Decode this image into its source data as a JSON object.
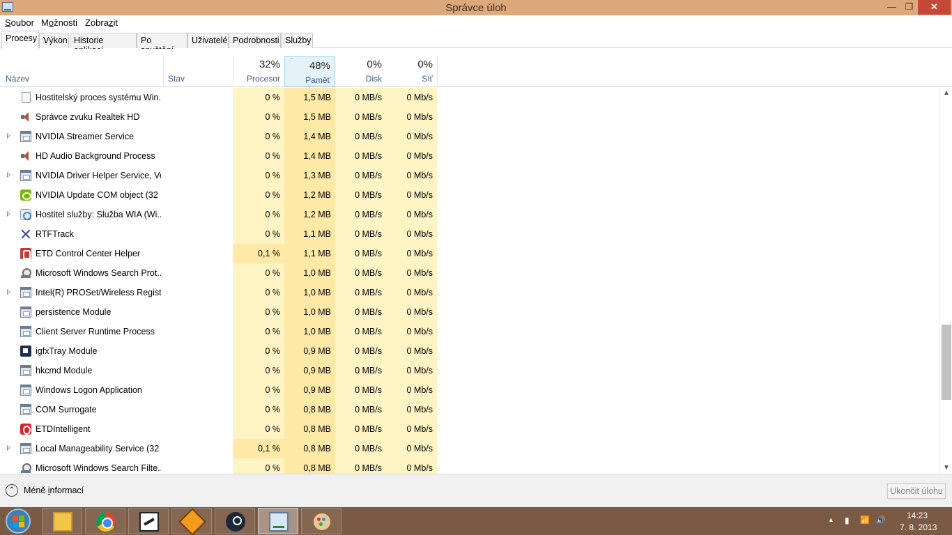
{
  "window": {
    "title": "Správce úloh",
    "minimize_icon": "minimize-icon",
    "maximize_icon": "maximize-icon",
    "close_icon": "close-icon",
    "minimize_glyph": "—",
    "maximize_glyph": "❐",
    "close_glyph": "✕"
  },
  "menu": [
    {
      "label": "Soubor",
      "underline": "S",
      "rest": "oubor"
    },
    {
      "label": "Možnosti",
      "pre": "M",
      "underline": "o",
      "rest": "žnosti"
    },
    {
      "label": "Zobrazit",
      "pre": "Zobra",
      "underline": "z",
      "rest": "it"
    }
  ],
  "tabs": [
    "Procesy",
    "Výkon",
    "Historie aplikací",
    "Po spuštění",
    "Uživatelé",
    "Podrobnosti",
    "Služby"
  ],
  "active_tab": "Procesy",
  "columns": {
    "name": "Název",
    "status": "Stav",
    "cpu": {
      "pct": "32%",
      "label": "Procesor"
    },
    "memory": {
      "pct": "48%",
      "label": "Paměť",
      "sort_glyph": "ˇ"
    },
    "disk": {
      "pct": "0%",
      "label": "Disk"
    },
    "network": {
      "pct": "0%",
      "label": "Síť"
    }
  },
  "processes": [
    {
      "name": "Hostitelský proces systému Win...",
      "icon": "doc-icon",
      "expandable": false,
      "cpu": "0 %",
      "mem": "1,5 MB",
      "disk": "0 MB/s",
      "net": "0 Mb/s"
    },
    {
      "name": "Správce zvuku Realtek HD",
      "icon": "speaker-icon",
      "expandable": false,
      "cpu": "0 %",
      "mem": "1,5 MB",
      "disk": "0 MB/s",
      "net": "0 Mb/s"
    },
    {
      "name": "NVIDIA Streamer Service",
      "icon": "window-app-icon",
      "expandable": true,
      "cpu": "0 %",
      "mem": "1,4 MB",
      "disk": "0 MB/s",
      "net": "0 Mb/s"
    },
    {
      "name": "HD Audio Background Process",
      "icon": "speaker-icon",
      "expandable": false,
      "cpu": "0 %",
      "mem": "1,4 MB",
      "disk": "0 MB/s",
      "net": "0 Mb/s"
    },
    {
      "name": "NVIDIA Driver Helper Service, Ve...",
      "icon": "window-app-icon",
      "expandable": true,
      "cpu": "0 %",
      "mem": "1,3 MB",
      "disk": "0 MB/s",
      "net": "0 Mb/s"
    },
    {
      "name": "NVIDIA Update COM object (32 ...",
      "icon": "nvidia-icon",
      "expandable": false,
      "cpu": "0 %",
      "mem": "1,2 MB",
      "disk": "0 MB/s",
      "net": "0 Mb/s"
    },
    {
      "name": "Hostitel služby: Služba WIA (Wi...",
      "icon": "gear-icon",
      "expandable": true,
      "cpu": "0 %",
      "mem": "1,2 MB",
      "disk": "0 MB/s",
      "net": "0 Mb/s"
    },
    {
      "name": "RTFTrack",
      "icon": "rtftrack-icon",
      "expandable": false,
      "cpu": "0 %",
      "mem": "1,1 MB",
      "disk": "0 MB/s",
      "net": "0 Mb/s"
    },
    {
      "name": "ETD Control Center Helper",
      "icon": "etd-icon",
      "expandable": false,
      "cpu": "0,1 %",
      "mem": "1,1 MB",
      "disk": "0 MB/s",
      "net": "0 Mb/s"
    },
    {
      "name": "Microsoft Windows Search Prot...",
      "icon": "search-user-icon",
      "expandable": false,
      "cpu": "0 %",
      "mem": "1,0 MB",
      "disk": "0 MB/s",
      "net": "0 Mb/s"
    },
    {
      "name": "Intel(R) PROSet/Wireless Registr...",
      "icon": "window-app-icon",
      "expandable": true,
      "cpu": "0 %",
      "mem": "1,0 MB",
      "disk": "0 MB/s",
      "net": "0 Mb/s"
    },
    {
      "name": "persistence Module",
      "icon": "window-app-icon",
      "expandable": false,
      "cpu": "0 %",
      "mem": "1,0 MB",
      "disk": "0 MB/s",
      "net": "0 Mb/s"
    },
    {
      "name": "Client Server Runtime Process",
      "icon": "window-app-icon",
      "expandable": false,
      "cpu": "0 %",
      "mem": "1,0 MB",
      "disk": "0 MB/s",
      "net": "0 Mb/s"
    },
    {
      "name": "igfxTray Module",
      "icon": "igfx-tray-icon",
      "expandable": false,
      "cpu": "0 %",
      "mem": "0,9 MB",
      "disk": "0 MB/s",
      "net": "0 Mb/s"
    },
    {
      "name": "hkcmd Module",
      "icon": "window-app-icon",
      "expandable": false,
      "cpu": "0 %",
      "mem": "0,9 MB",
      "disk": "0 MB/s",
      "net": "0 Mb/s"
    },
    {
      "name": "Windows Logon Application",
      "icon": "window-app-icon",
      "expandable": false,
      "cpu": "0 %",
      "mem": "0,9 MB",
      "disk": "0 MB/s",
      "net": "0 Mb/s"
    },
    {
      "name": "COM Surrogate",
      "icon": "window-app-icon",
      "expandable": false,
      "cpu": "0 %",
      "mem": "0,8 MB",
      "disk": "0 MB/s",
      "net": "0 Mb/s"
    },
    {
      "name": "ETDIntelligent",
      "icon": "etd-intelligent-icon",
      "expandable": false,
      "cpu": "0 %",
      "mem": "0,8 MB",
      "disk": "0 MB/s",
      "net": "0 Mb/s"
    },
    {
      "name": "Local Manageability Service (32 ...",
      "icon": "window-app-icon",
      "expandable": true,
      "cpu": "0,1 %",
      "mem": "0,8 MB",
      "disk": "0 MB/s",
      "net": "0 Mb/s"
    },
    {
      "name": "Microsoft Windows Search Filte...",
      "icon": "search-user-icon",
      "expandable": false,
      "cpu": "0 %",
      "mem": "0,8 MB",
      "disk": "0 MB/s",
      "net": "0 Mb/s"
    }
  ],
  "footer": {
    "less_details": "Méně informací",
    "less_underline_pre": "Méně ",
    "less_underline": "i",
    "less_rest": "nformací",
    "end_task": "Ukončit úlohu",
    "collapse_glyph": "⌃"
  },
  "scrollbar": {
    "up_glyph": "▲",
    "down_glyph": "▼"
  },
  "taskbar": {
    "apps": [
      {
        "name": "file-explorer",
        "icon": "folder-icon",
        "active": false
      },
      {
        "name": "chrome",
        "icon": "chrome-icon",
        "active": false
      },
      {
        "name": "app-3",
        "icon": "app-icon",
        "active": false
      },
      {
        "name": "winamp",
        "icon": "winamp-icon",
        "active": false
      },
      {
        "name": "steam",
        "icon": "steam-icon",
        "active": false
      },
      {
        "name": "task-manager",
        "icon": "task-manager-icon",
        "active": true
      },
      {
        "name": "paint",
        "icon": "paint-icon",
        "active": false
      }
    ],
    "tray": {
      "show_hidden_glyph": "▲",
      "battery_glyph": "▮",
      "signal_glyph": "📶",
      "volume_glyph": "🔊"
    },
    "time": "14:23",
    "date": "7. 8. 2013"
  }
}
